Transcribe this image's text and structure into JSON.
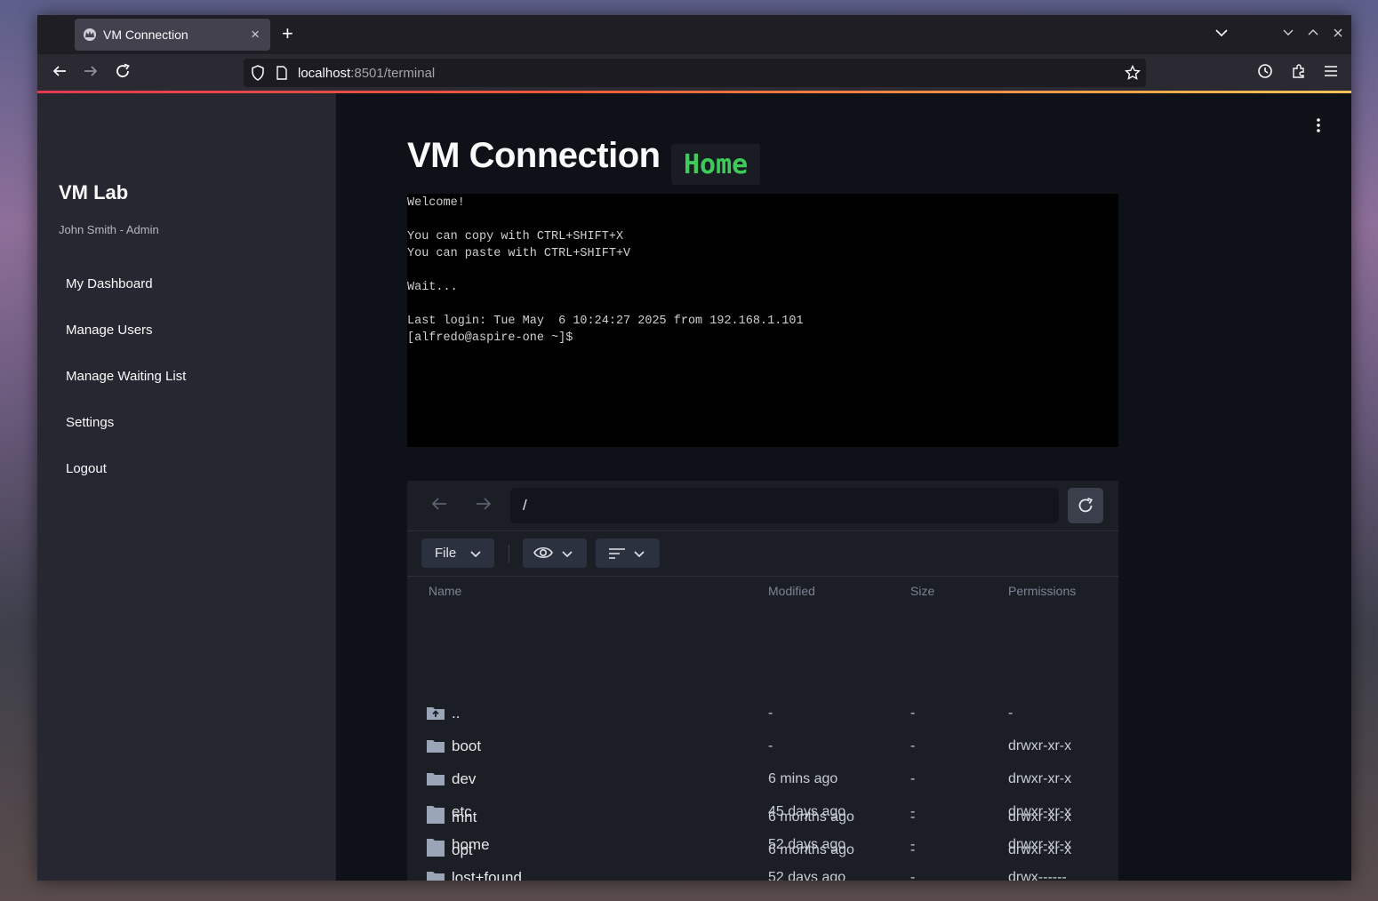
{
  "browser": {
    "tab_title": "VM Connection",
    "url_host": "localhost",
    "url_path": ":8501/terminal"
  },
  "sidebar": {
    "brand": "VM Lab",
    "user": "John Smith - Admin",
    "items": [
      {
        "label": "My Dashboard"
      },
      {
        "label": "Manage Users"
      },
      {
        "label": "Manage Waiting List"
      },
      {
        "label": "Settings"
      },
      {
        "label": "Logout"
      }
    ]
  },
  "main": {
    "title": "VM Connection",
    "badge": "Home",
    "terminal_text": "Welcome!\n\nYou can copy with CTRL+SHIFT+X\nYou can paste with CTRL+SHIFT+V\n\nWait...\n\nLast login: Tue May  6 10:24:27 2025 from 192.168.1.101\n[alfredo@aspire-one ~]$"
  },
  "file_manager": {
    "path": "/",
    "file_menu_label": "File",
    "columns": {
      "name": "Name",
      "modified": "Modified",
      "size": "Size",
      "permissions": "Permissions"
    },
    "rows": [
      {
        "name": "..",
        "modified": "-",
        "size": "-",
        "permissions": "-",
        "icon": "parent-folder-icon"
      },
      {
        "name": "boot",
        "modified": "-",
        "size": "-",
        "permissions": "drwxr-xr-x",
        "icon": "folder-icon"
      },
      {
        "name": "dev",
        "modified": "6 mins ago",
        "size": "-",
        "permissions": "drwxr-xr-x",
        "icon": "folder-icon"
      },
      {
        "name": "etc",
        "modified": "45 days ago",
        "size": "-",
        "permissions": "drwxr-xr-x",
        "icon": "folder-icon"
      },
      {
        "name": "home",
        "modified": "52 days ago",
        "size": "-",
        "permissions": "drwxr-xr-x",
        "icon": "folder-icon"
      },
      {
        "name": "lost+found",
        "modified": "52 days ago",
        "size": "-",
        "permissions": "drwx------",
        "icon": "folder-icon"
      },
      {
        "name": "mnt",
        "modified": "6 months ago",
        "size": "-",
        "permissions": "drwxr-xr-x",
        "icon": "folder-icon"
      },
      {
        "name": "opt",
        "modified": "6 months ago",
        "size": "-",
        "permissions": "drwxr-xr-x",
        "icon": "folder-icon"
      }
    ]
  },
  "colors": {
    "accent_green": "#3dcc5a",
    "sidebar_bg": "#262730",
    "main_bg": "#0e1117"
  }
}
